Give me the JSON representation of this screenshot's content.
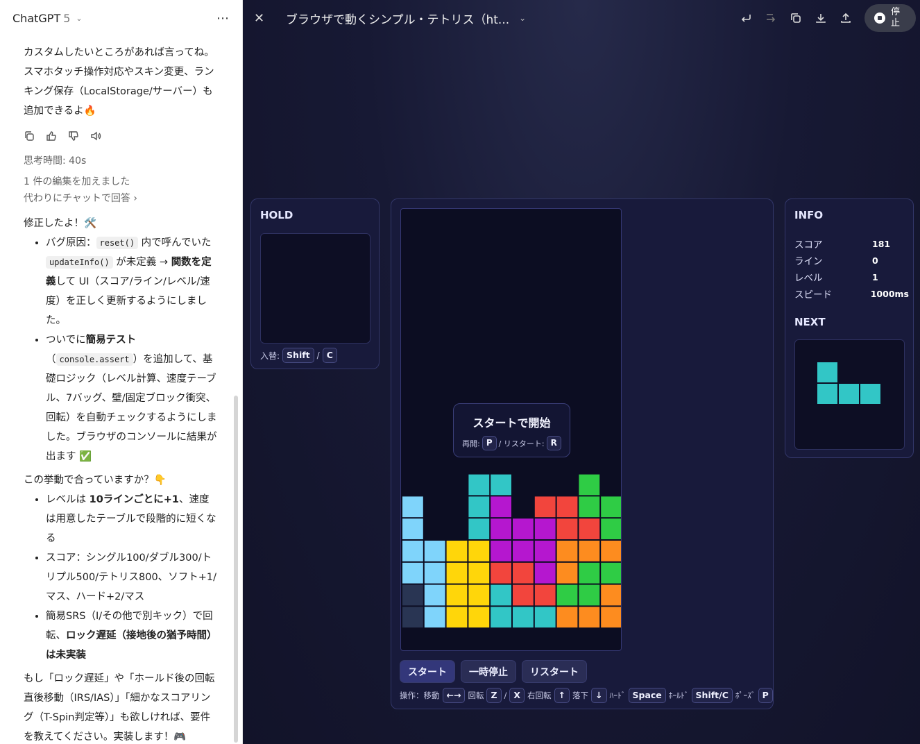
{
  "chat": {
    "model": "ChatGPT",
    "model_version": "5",
    "intro": "カスタムしたいところがあれば言ってね。スマホタッチ操作対応やスキン変更、ランキング保存（LocalStorage/サーバー）も追加できるよ🔥",
    "think_time": "思考時間: 40s",
    "edit_note": "1 件の編集を加えました",
    "alt_reply": "代わりにチャットで回答",
    "fixed_heading": "修正したよ！🛠️",
    "bug1_a": "バグ原因：",
    "bug1_code1": "reset()",
    "bug1_b": " 内で呼んでいた ",
    "bug1_code2": "updateInfo()",
    "bug1_c": " が未定義 → ",
    "bug1_bold": "関数を定義",
    "bug1_d": "して UI（スコア/ライン/レベル/速度）を正しく更新するようにしました。",
    "bug2_a": "ついでに",
    "bug2_bold": "簡易テスト",
    "bug2_b": "（",
    "bug2_code": "console.assert",
    "bug2_c": "）を追加して、基礎ロジック（レベル計算、速度テーブル、7バッグ、壁/固定ブロック衝突、回転）を自動チェックするようにしました。ブラウザのコンソールに結果が出ます ✅",
    "question": "この挙動で合っていますか？👇",
    "q1_a": "レベルは ",
    "q1_bold": "10ラインごとに+1",
    "q1_b": "、速度は用意したテーブルで段階的に短くなる",
    "q2": "スコア：シングル100/ダブル300/トリプル500/テトリス800、ソフト+1/マス、ハード+2/マス",
    "q3_a": "簡易SRS（I/その他で別キック）で回転、",
    "q3_bold": "ロック遅延（接地後の猶予時間）は未実装",
    "closing": "もし「ロック遅延」や「ホールド後の回転直後移動（IRS/IAS）」「細かなスコアリング（T-Spin判定等）」も欲しければ、要件を教えてください。実装します！🎮"
  },
  "canvas": {
    "title": "ブラウザで動くシンプル・テトリス（ht...",
    "stop_label": "停止",
    "icons": [
      "close-icon",
      "chevron-down-icon",
      "undo-icon",
      "redo-icon",
      "copy-icon",
      "download-icon",
      "share-icon",
      "stop-icon"
    ]
  },
  "hold": {
    "title": "HOLD",
    "hint_label": "入替:",
    "key1": "Shift",
    "sep": "/",
    "key2": "C"
  },
  "overlay": {
    "title": "スタートで開始",
    "resume_label": "再開:",
    "resume_key": "P",
    "restart_label": "/ リスタート:",
    "restart_key": "R"
  },
  "buttons": {
    "start": "スタート",
    "pause": "一時停止",
    "restart": "リスタート"
  },
  "ops": {
    "label": "操作：移動",
    "move_key": "←→",
    "rotate_label": "回転",
    "rotate_key1": "Z",
    "rotate_sep": "/",
    "rotate_key2": "X",
    "rrotate_label": "右回転",
    "rrotate_key": "↑",
    "drop_label": "落下",
    "drop_key": "↓",
    "hard_label": "ﾊｰﾄﾞ",
    "hard_key": "Space",
    "hold_label": "ﾎｰﾙﾄﾞ",
    "hold_key": "Shift/C",
    "pause_label": "ﾎﾟｰｽﾞ",
    "pause_key": "P"
  },
  "info": {
    "title": "INFO",
    "score_label": "スコア",
    "score": "181",
    "lines_label": "ライン",
    "lines": "0",
    "level_label": "レベル",
    "level": "1",
    "speed_label": "スピード",
    "speed": "1000ms",
    "next_title": "NEXT"
  },
  "colors": {
    "I": "#7fd4fb",
    "O": "#ffd60a",
    "T": "#b517cf",
    "S": "#2fcc45",
    "Z": "#f2453d",
    "J": "#32c6c6",
    "L": "#fd8c1f",
    "G": "#293553"
  },
  "board": {
    "cols": 10,
    "rows": 20,
    "rows_data": [
      "..........",
      "..........",
      "..........",
      "..........",
      "..........",
      "..........",
      "..........",
      "..........",
      "..........",
      "..........",
      "..........",
      "..........",
      "...JJ...S.",
      "I..JT.ZZSS",
      "I..JTTTZZS",
      "IIOOTTTLLL",
      "IIOOZZTLSS",
      "GIOOJZZSSL",
      "GIOOJJJLLL",
      ".........."
    ]
  },
  "next": {
    "piece": "J",
    "cells": [
      [
        0,
        0
      ],
      [
        0,
        1
      ],
      [
        1,
        1
      ],
      [
        2,
        1
      ]
    ]
  }
}
